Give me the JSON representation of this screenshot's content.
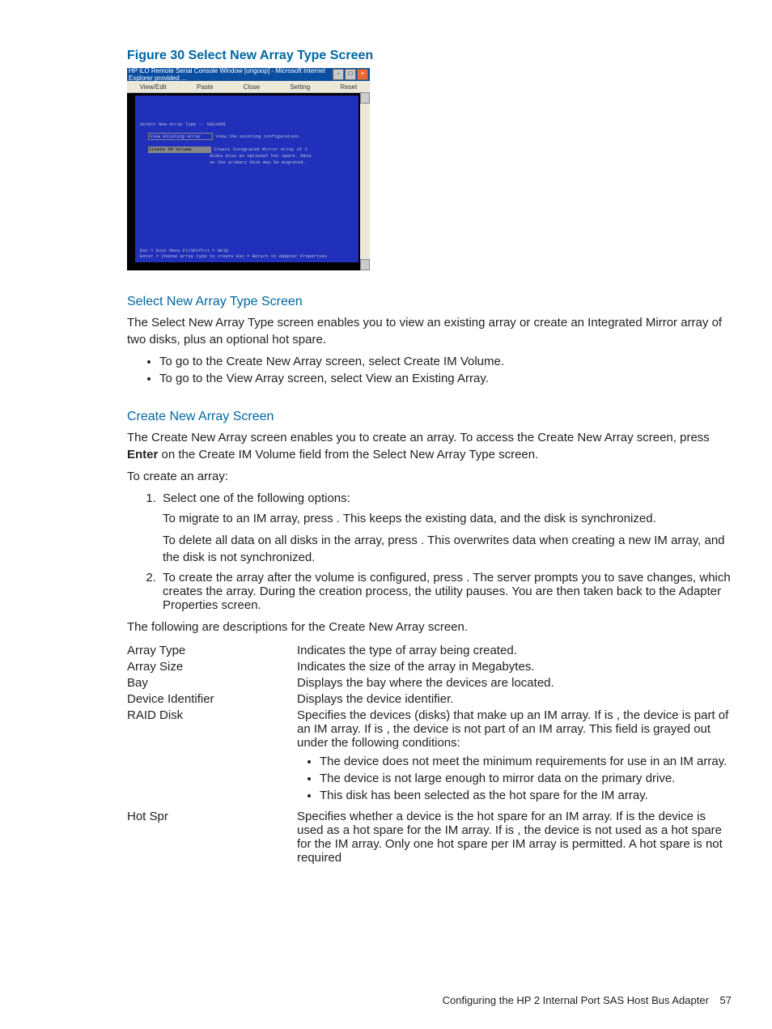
{
  "figure": {
    "label": "Figure 30 Select New Array Type Screen",
    "window_title": "HP iLO Remote Serial Console Window [ungoop] - Microsoft Internet Explorer provided ...",
    "menubar": [
      "View/Edit",
      "Paste",
      "Close",
      "Setting",
      "Reset"
    ],
    "console_header": "Select New Array Type -- SAS1068",
    "row1": {
      "label": "View Existing Array",
      "desc": "View the existing configuration."
    },
    "row2": {
      "label": "Create IM Volume",
      "desc1": "Create Integrated Mirror Array of 2",
      "desc2": "disks plus an optional hot spare. Data",
      "desc3": "on the primary disk may be migrated."
    },
    "footer1": "Esc = Exit Menu    F1/Shift+1 = Help",
    "footer2": "Enter = Choose array type to create    Esc = Return to Adapter Properties"
  },
  "section1": {
    "heading": "Select New Array Type Screen",
    "p1": "The Select New Array Type screen enables you to view an existing array or create an Integrated Mirror array of two disks, plus an optional hot spare.",
    "b1": "To go to the Create New Array screen, select Create IM Volume.",
    "b2": "To go to the View Array screen, select View an Existing Array."
  },
  "section2": {
    "heading": "Create New Array Screen",
    "p1a": "The Create New Array screen enables you to create an array. To access the Create New Array screen, press ",
    "p1b": "Enter",
    "p1c": " on the Create IM Volume field from the Select New Array Type screen.",
    "p2": "To create an array:",
    "step1_intro": "Select one of the following options:",
    "step1_opt1": "To migrate to an IM array, press   . This keeps the existing data, and the disk is synchronized.",
    "step1_opt2": "To delete all data on all disks in the array, press   . This overwrites data when creating a new IM array, and the disk is not synchronized.",
    "step2": "To create the array after the volume is configured, press   . The server prompts you to save changes, which creates the array. During the creation process, the utility pauses. You are then taken back to the Adapter Properties screen.",
    "p3": "The following are descriptions for the Create New Array screen."
  },
  "defs": {
    "array_type": {
      "term": "Array Type",
      "body": "Indicates the type of array being created."
    },
    "array_size": {
      "term": "Array Size",
      "body": "Indicates the size of the array in Megabytes."
    },
    "bay": {
      "term": "Bay",
      "body": "Displays the bay where the devices are located."
    },
    "dev_id": {
      "term": "Device Identifier",
      "body": "Displays the device identifier."
    },
    "raid_disk": {
      "term": "RAID Disk",
      "body": "Specifies the devices (disks) that make up an IM array. If               is       , the device is part of an IM array. If                         is       , the device is not part of an IM array. This field is grayed out under the following conditions:",
      "b1": "The device does not meet the minimum requirements for use in an IM array.",
      "b2": "The device is not large enough to mirror data on the primary drive.",
      "b3": "This disk has been selected as the hot spare for the IM array."
    },
    "hot_spr": {
      "term": "Hot Spr",
      "body": "Specifies whether a device is the hot spare for an IM array. If               is        the device is used as a hot spare for the IM array. If               is       , the device is not used as a hot spare for the IM array. Only one hot spare per IM array is permitted. A hot spare is not required"
    }
  },
  "footer": {
    "text": "Configuring the HP 2 Internal Port SAS Host Bus Adapter",
    "page": "57"
  }
}
